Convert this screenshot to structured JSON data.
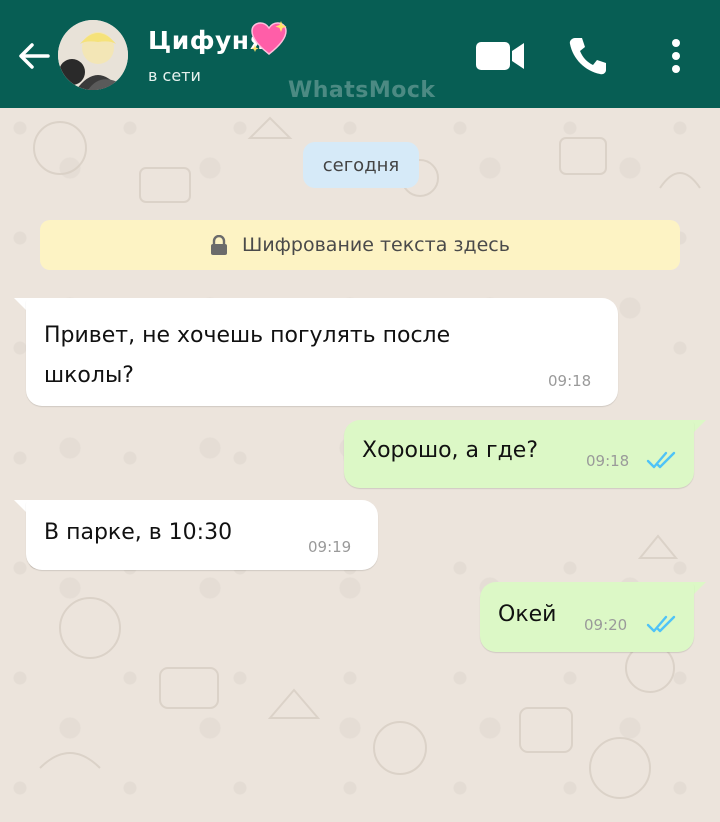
{
  "header": {
    "contact_name": "Цифуня",
    "status": "в сети",
    "watermark": "WhatsMock"
  },
  "chat": {
    "date_chip": "сегодня",
    "encryption_notice": "Шифрование текста здесь",
    "messages": [
      {
        "direction": "incoming",
        "text": "Привет, не хочешь погулять после школы?",
        "time": "09:18"
      },
      {
        "direction": "outgoing",
        "text": "Хорошо, а где?",
        "time": "09:18",
        "status": "read"
      },
      {
        "direction": "incoming",
        "text": "В парке, в 10:30",
        "time": "09:19"
      },
      {
        "direction": "outgoing",
        "text": "Окей",
        "time": "09:20",
        "status": "read"
      }
    ]
  },
  "icons": {
    "back": "arrow-left-icon",
    "video": "video-camera-icon",
    "call": "phone-icon",
    "menu": "more-vertical-icon",
    "heart": "sparkling-heart-icon",
    "lock": "lock-icon",
    "ticks": "double-check-icon"
  },
  "colors": {
    "header": "#075e54",
    "incoming_bubble": "#ffffff",
    "outgoing_bubble": "#dcf8c6",
    "read_ticks": "#4fc3f7",
    "date_chip": "#d6eaf8",
    "encryption_banner": "#fdf3c4",
    "wallpaper": "#ece4dc"
  }
}
